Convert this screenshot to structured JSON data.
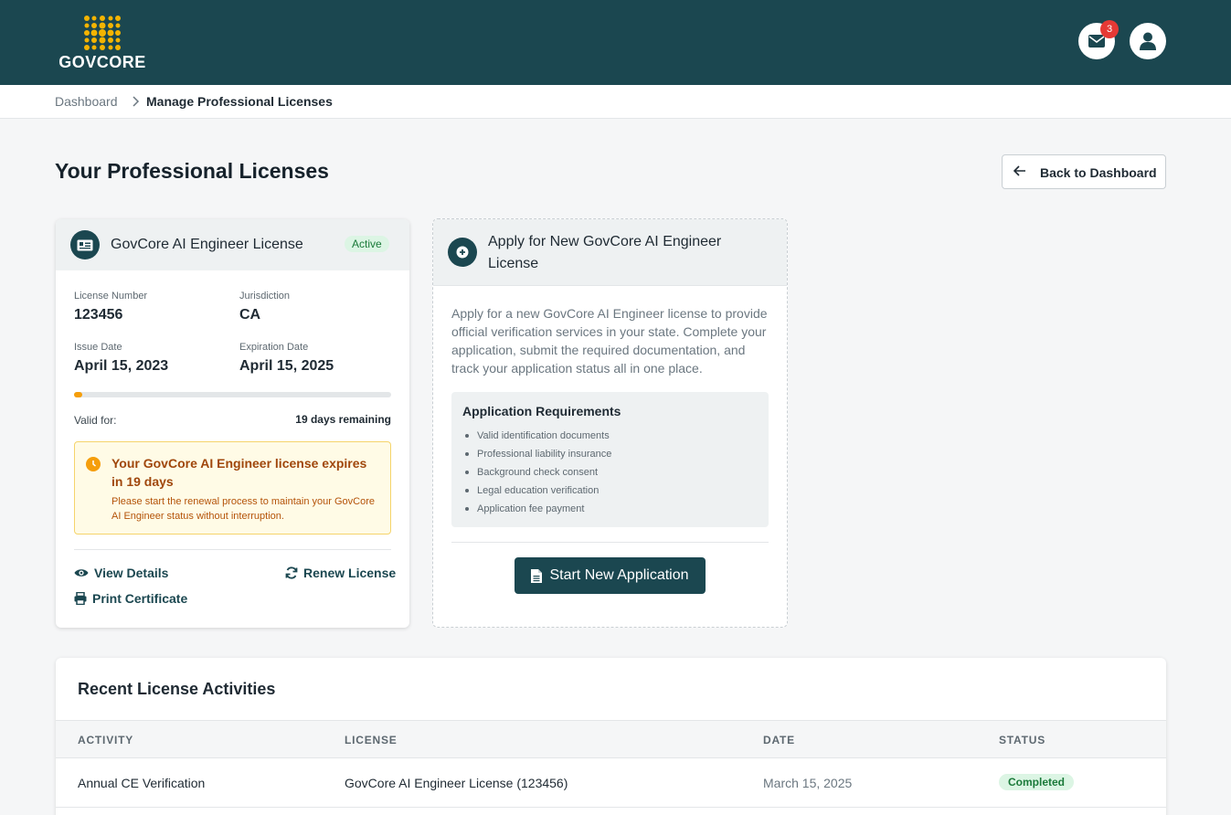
{
  "header": {
    "logo_text": "GOVCORE",
    "notification_count": "3",
    "brand_color": "#1b4750",
    "accent_color": "#f4b400"
  },
  "breadcrumb": {
    "home": "Dashboard",
    "current": "Manage Professional Licenses"
  },
  "page": {
    "title": "Your Professional Licenses",
    "back_button": "Back to Dashboard"
  },
  "license": {
    "title": "GovCore AI Engineer License",
    "status": "Active",
    "license_number_label": "License Number",
    "license_number": "123456",
    "jurisdiction_label": "Jurisdiction",
    "jurisdiction": "CA",
    "issue_date_label": "Issue Date",
    "issue_date": "April 15, 2023",
    "expiration_date_label": "Expiration Date",
    "expiration_date": "April 15, 2025",
    "validity_progress_percent": 2.6,
    "valid_for_label": "Valid for:",
    "valid_for_value": "19 days remaining",
    "warning_title": "Your GovCore AI Engineer license expires in 19 days",
    "warning_text": "Please start the renewal process to maintain your GovCore AI Engineer status without interruption.",
    "actions": {
      "view_details": "View Details",
      "renew": "Renew License",
      "print": "Print Certificate"
    }
  },
  "apply": {
    "title": "Apply for New GovCore AI Engineer License",
    "description": "Apply for a new GovCore AI Engineer license to provide official verification services in your state. Complete your application, submit the required documentation, and track your application status all in one place.",
    "requirements_title": "Application Requirements",
    "requirements": [
      "Valid identification documents",
      "Professional liability insurance",
      "Background check consent",
      "Legal education verification",
      "Application fee payment"
    ],
    "button": "Start New Application"
  },
  "activities": {
    "title": "Recent License Activities",
    "columns": [
      "ACTIVITY",
      "LICENSE",
      "DATE",
      "STATUS"
    ],
    "rows": [
      {
        "activity": "Annual CE Verification",
        "license": "GovCore AI Engineer License (123456)",
        "date": "March 15, 2025",
        "status": "Completed"
      }
    ]
  }
}
